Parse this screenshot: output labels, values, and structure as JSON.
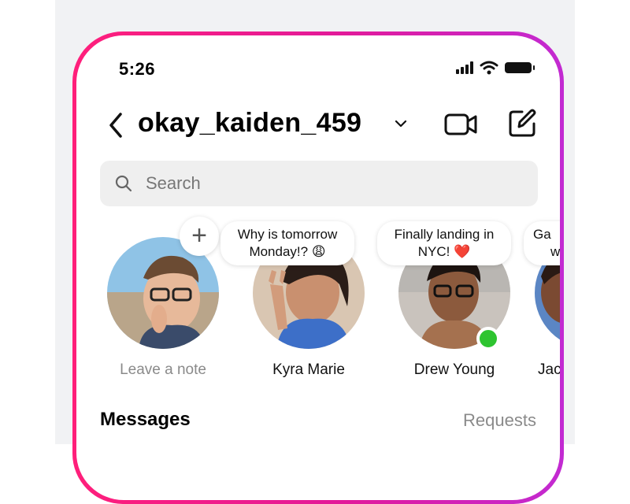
{
  "status_bar": {
    "time": "5:26"
  },
  "header": {
    "account_name": "okay_kaiden_459"
  },
  "search": {
    "placeholder": "Search"
  },
  "notes": [
    {
      "name": "Leave a note",
      "note": ""
    },
    {
      "name": "Kyra Marie",
      "note_line1": "Why is tomorrow",
      "note_line2": "Monday!? 😩"
    },
    {
      "name": "Drew Young",
      "note_line1": "Finally landing in",
      "note_line2": "NYC! ❤️"
    },
    {
      "name": "Jac",
      "note_line1": "Ga",
      "note_line2": "w"
    }
  ],
  "sections": {
    "messages_title": "Messages",
    "requests_label": "Requests"
  },
  "colors": {
    "frame_start": "#ff1f7a",
    "frame_end": "#c22ad2",
    "online": "#2ec430"
  }
}
